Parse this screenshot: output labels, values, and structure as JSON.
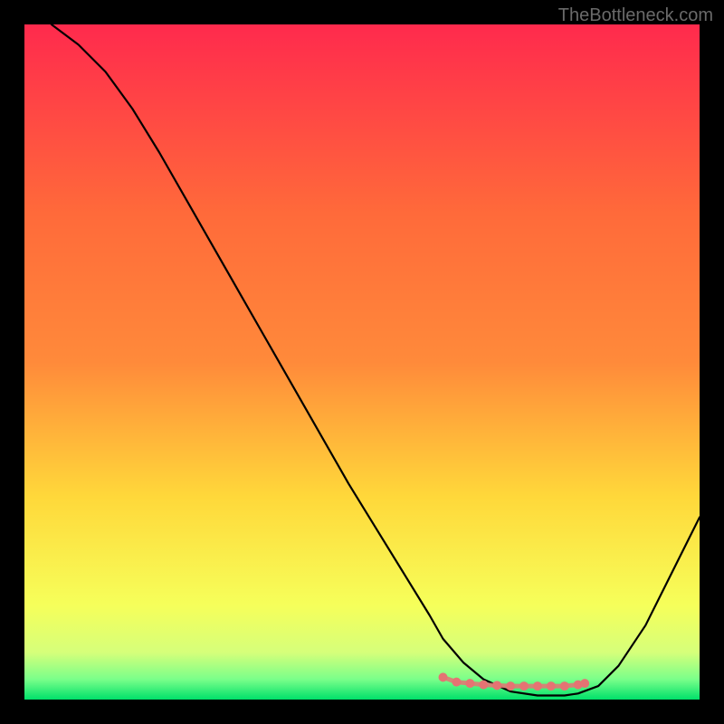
{
  "watermark": "TheBottleneck.com",
  "chart_data": {
    "type": "line",
    "title": "",
    "xlabel": "",
    "ylabel": "",
    "xlim": [
      0,
      100
    ],
    "ylim": [
      0,
      100
    ],
    "background_gradient": {
      "top": "#ff2a4d",
      "mid_upper": "#ff8a3a",
      "mid": "#ffd83a",
      "mid_lower": "#f6ff5a",
      "near_bottom": "#d6ff7a",
      "bottom": "#00e06a"
    },
    "series": [
      {
        "name": "bottleneck-curve",
        "color": "#000000",
        "x": [
          4,
          8,
          12,
          16,
          20,
          24,
          28,
          32,
          36,
          40,
          44,
          48,
          52,
          56,
          60,
          62,
          65,
          68,
          72,
          76,
          80,
          82,
          85,
          88,
          92,
          96,
          100
        ],
        "y": [
          100,
          97,
          93,
          87.5,
          81,
          74,
          67,
          60,
          53,
          46,
          39,
          32,
          25.5,
          19,
          12.5,
          9,
          5.5,
          3,
          1.2,
          0.6,
          0.6,
          0.9,
          2,
          5,
          11,
          19,
          27
        ]
      },
      {
        "name": "highlight-dots",
        "color": "#e57373",
        "x": [
          62,
          64,
          66,
          68,
          70,
          72,
          74,
          76,
          78,
          80,
          82,
          83
        ],
        "y": [
          3.3,
          2.6,
          2.4,
          2.2,
          2.1,
          2.0,
          2.0,
          2.0,
          2.0,
          2.0,
          2.2,
          2.4
        ]
      }
    ]
  }
}
